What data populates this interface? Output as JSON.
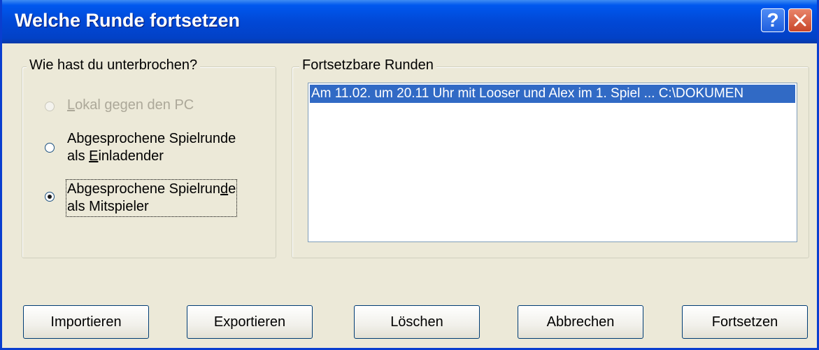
{
  "window": {
    "title": "Welche Runde fortsetzen",
    "help_label": "?",
    "accent": "#0a3ecf"
  },
  "interruption_group": {
    "legend": "Wie hast du unterbrochen?",
    "options": [
      {
        "pre": "",
        "ul": "L",
        "post": "okal gegen den PC",
        "state": "disabled"
      },
      {
        "line1": "Abgesprochene Spielrunde",
        "line2_pre": "als ",
        "line2_ul": "E",
        "line2_post": "inladender",
        "state": "unselected"
      },
      {
        "line1_pre": "Abgesprochene Spielrun",
        "line1_ul": "d",
        "line1_post": "e",
        "line2": "als Mitspieler",
        "state": "selected"
      }
    ]
  },
  "rounds_group": {
    "legend": "Fortsetzbare Runden",
    "items": [
      {
        "text": "Am 11.02. um 20.11 Uhr mit Looser und Alex im 1. Spiel ... C:\\DOKUMEN",
        "selected": true
      }
    ]
  },
  "buttons": {
    "import": "Importieren",
    "export": "Exportieren",
    "delete": "Löschen",
    "cancel": "Abbrechen",
    "continue": "Fortsetzen"
  }
}
